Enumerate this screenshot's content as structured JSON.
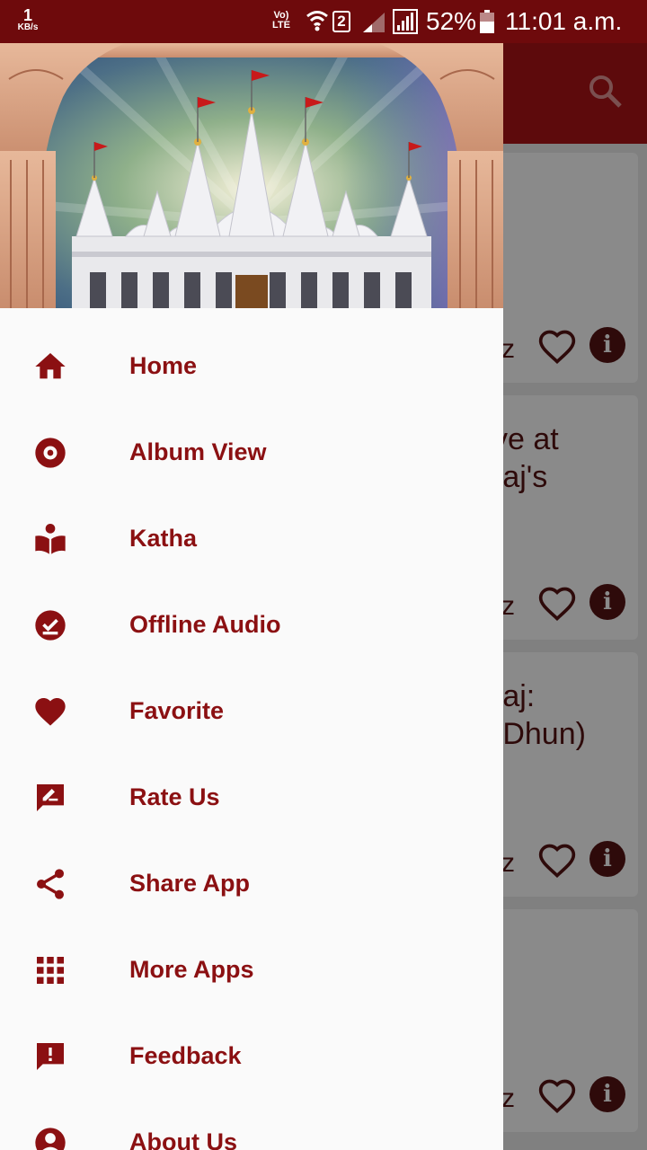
{
  "status_bar": {
    "net_speed_value": "1",
    "net_speed_unit": "KB/s",
    "volte_top": "Vo)",
    "volte_bottom": "LTE",
    "sim_number": "2",
    "battery_percent": "52%",
    "time": "11:01 a.m.",
    "icons": [
      "wifi-icon",
      "signal-icon",
      "battery-icon"
    ]
  },
  "colors": {
    "status_bar": "#6e0a0c",
    "primary": "#8b1012",
    "drawer_bg": "#fafafa",
    "scrim": "#808080"
  },
  "drawer": {
    "header_image": "temple-illustration",
    "items": [
      {
        "label": "Home",
        "icon": "home-icon"
      },
      {
        "label": "Album View",
        "icon": "album-icon"
      },
      {
        "label": "Katha",
        "icon": "book-reader-icon"
      },
      {
        "label": "Offline Audio",
        "icon": "offline-check-icon"
      },
      {
        "label": "Favorite",
        "icon": "heart-icon"
      },
      {
        "label": "Rate Us",
        "icon": "rate-icon"
      },
      {
        "label": "Share App",
        "icon": "share-icon"
      },
      {
        "label": "More Apps",
        "icon": "apps-grid-icon"
      },
      {
        "label": "Feedback",
        "icon": "feedback-icon"
      },
      {
        "label": "About Us",
        "icon": "account-icon"
      }
    ]
  },
  "background": {
    "search_icon": "search-icon",
    "cards": [
      {
        "title": ""
      },
      {
        "title": "ve at\nraj's"
      },
      {
        "title": "raj:\n(Dhun)"
      },
      {
        "title": ""
      }
    ]
  }
}
